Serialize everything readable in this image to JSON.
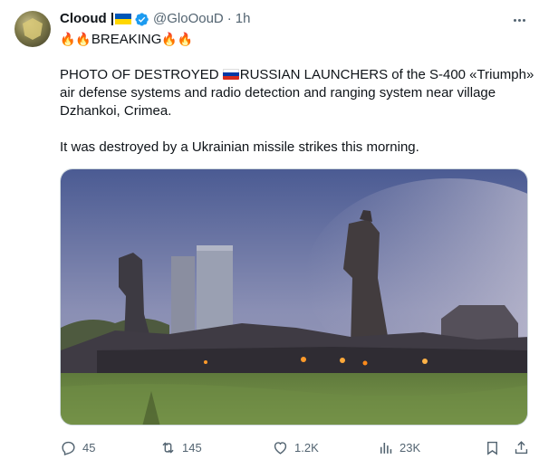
{
  "author": {
    "display_name": "Clooud |",
    "handle": "@GloOouD",
    "separator": "·",
    "time": "1h"
  },
  "tweet": {
    "headline": "BREAKING",
    "paragraph1_a": "PHOTO OF DESTROYED ",
    "paragraph1_b": "RUSSIAN LAUNCHERS of the S-400 «Triumph»",
    "paragraph1_line2": "air defense systems and radio detection and ranging system near village",
    "paragraph1_line3": "Dzhankoi, Crimea.",
    "paragraph2": "It was destroyed by a Ukrainian missile strikes this morning."
  },
  "actions": {
    "replies": "45",
    "reposts": "145",
    "likes": "1.2K",
    "views": "23K"
  },
  "colors": {
    "text": "#0f1419",
    "muted": "#536471",
    "verified": "#1d9bf0"
  },
  "icons": [
    "verified-badge-icon",
    "more-icon",
    "fire-emoji",
    "ukraine-flag",
    "russia-flag",
    "reply-icon",
    "repost-icon",
    "like-icon",
    "views-icon",
    "bookmark-icon",
    "share-icon"
  ]
}
